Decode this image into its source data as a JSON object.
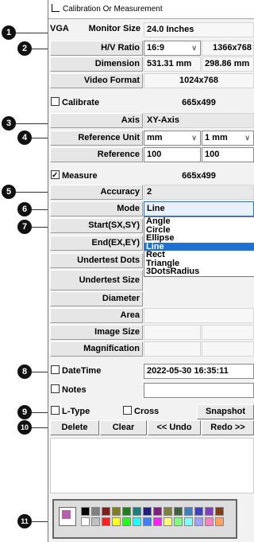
{
  "window": {
    "title": "Calibration Or Measurement"
  },
  "monitor": {
    "vga_label": "VGA",
    "size_label": "Monitor Size",
    "size_value": "24.0 Inches",
    "ratio_label": "H/V Ratio",
    "ratio_value": "16:9",
    "resolution_value": "1366x768",
    "dimension_label": "Dimension",
    "dim_w": "531.31 mm",
    "dim_h": "298.86 mm",
    "video_format_label": "Video Format",
    "video_format_value": "1024x768"
  },
  "calibrate": {
    "label": "Calibrate",
    "checked": false,
    "size_value": "665x499",
    "axis_label": "Axis",
    "axis_value": "XY-Axis",
    "ref_unit_label": "Reference Unit",
    "ref_unit_a": "mm",
    "ref_unit_b": "1 mm",
    "reference_label": "Reference",
    "reference_a": "100",
    "reference_b": "100"
  },
  "measure": {
    "label": "Measure",
    "checked": true,
    "size_value": "665x499",
    "accuracy_label": "Accuracy",
    "accuracy_value": "2",
    "mode_label": "Mode",
    "mode_value": "Line",
    "start_label": "Start(SX,SY)",
    "end_label": "End(EX,EY)",
    "undertest_dots_label": "Undertest Dots",
    "undertest_size_label": "Undertest Size",
    "diameter_label": "Diameter",
    "area_label": "Area",
    "image_size_label": "Image Size",
    "magnification_label": "Magnification"
  },
  "mode_options": [
    "Angle",
    "Circle",
    "Ellipse",
    "Line",
    "Rect",
    "Triangle",
    "3DotsRadius"
  ],
  "mode_selected_index": 3,
  "datetime": {
    "label": "DateTime",
    "value": "2022-05-30  16:35:11"
  },
  "notes": {
    "label": "Notes",
    "value": ""
  },
  "tools": {
    "ltype_label": "L-Type",
    "cross_label": "Cross",
    "snapshot_label": "Snapshot"
  },
  "actions": {
    "delete": "Delete",
    "clear": "Clear",
    "undo": "<< Undo",
    "redo": "Redo >>"
  },
  "markers": [
    "1",
    "2",
    "3",
    "4",
    "5",
    "6",
    "7",
    "8",
    "9",
    "10",
    "11"
  ],
  "palette": {
    "current": "#b361ad",
    "row1": [
      "#000000",
      "#808080",
      "#7f1f1f",
      "#7f7f1f",
      "#1f7f1f",
      "#1f7f7f",
      "#1f1f7f",
      "#7f1f7f",
      "#7f7f3f",
      "#3f5f3f",
      "#3f7fbf",
      "#3f3fbf",
      "#7f3fbf",
      "#7f3f1f"
    ],
    "row2": [
      "#ffffff",
      "#c0c0c0",
      "#ff2020",
      "#ffff20",
      "#20ff20",
      "#20ffff",
      "#3f7fff",
      "#ff20ff",
      "#ffff80",
      "#80ff80",
      "#80ffff",
      "#a0a0ff",
      "#ff80c0",
      "#ff9f60"
    ]
  }
}
